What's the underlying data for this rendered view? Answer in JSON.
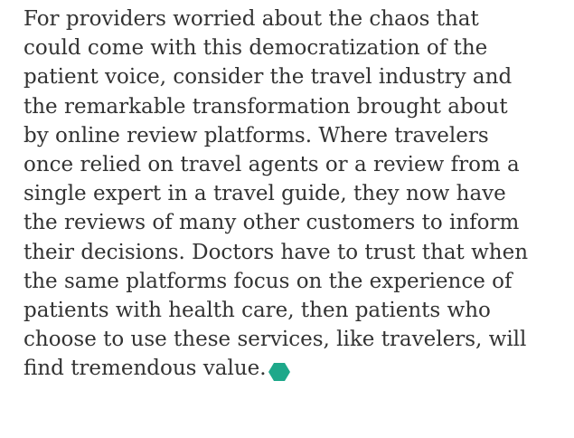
{
  "article": {
    "paragraph_lines": [
      "For providers worried about the chaos that",
      "could come with this democratization of the",
      "patient voice, consider the travel industry and",
      "the remarkable transformation brought about",
      "by online review platforms. Where travelers",
      "once relied on travel agents or a review from a",
      "single expert in a travel guide, they now have",
      "the reviews of many other customers to inform",
      "their decisions. Doctors have to trust that when",
      "the same platforms focus on the experience of",
      "patients with health care, then patients who",
      "choose to use these services, like travelers, will",
      "find tremendous value."
    ],
    "end_mark": {
      "icon": "hexagon-end-mark-icon",
      "color": "#1ea88a"
    }
  }
}
